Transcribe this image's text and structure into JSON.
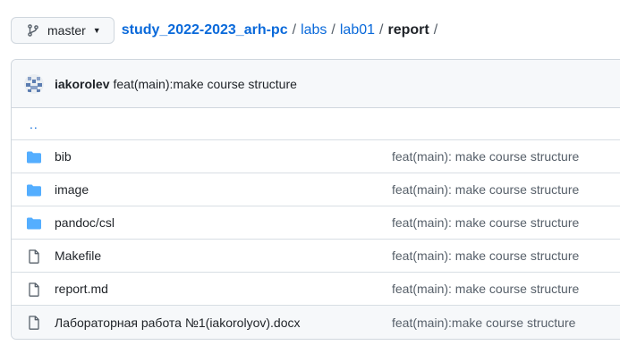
{
  "branch": {
    "name": "master",
    "icon": "git-branch-icon"
  },
  "breadcrumb": {
    "repo": "study_2022-2023_arh-pc",
    "parts": [
      "labs",
      "lab01"
    ],
    "current": "report",
    "separator": "/"
  },
  "commit": {
    "author": "iakorolev",
    "message": "feat(main):make course structure"
  },
  "parent_link": "..",
  "files": [
    {
      "name": "bib",
      "type": "folder",
      "message": "feat(main): make course structure"
    },
    {
      "name": "image",
      "type": "folder",
      "message": "feat(main): make course structure"
    },
    {
      "name": "pandoc/csl",
      "type": "folder",
      "message": "feat(main): make course structure"
    },
    {
      "name": "Makefile",
      "type": "file",
      "message": "feat(main): make course structure"
    },
    {
      "name": "report.md",
      "type": "file",
      "message": "feat(main): make course structure"
    },
    {
      "name": "Лабораторная работа №1(iakorolyov).docx",
      "type": "file",
      "message": "feat(main):make course structure"
    }
  ],
  "colors": {
    "link": "#0969da",
    "folder": "#54aeff",
    "file": "#57606a",
    "border": "#d0d7de"
  }
}
